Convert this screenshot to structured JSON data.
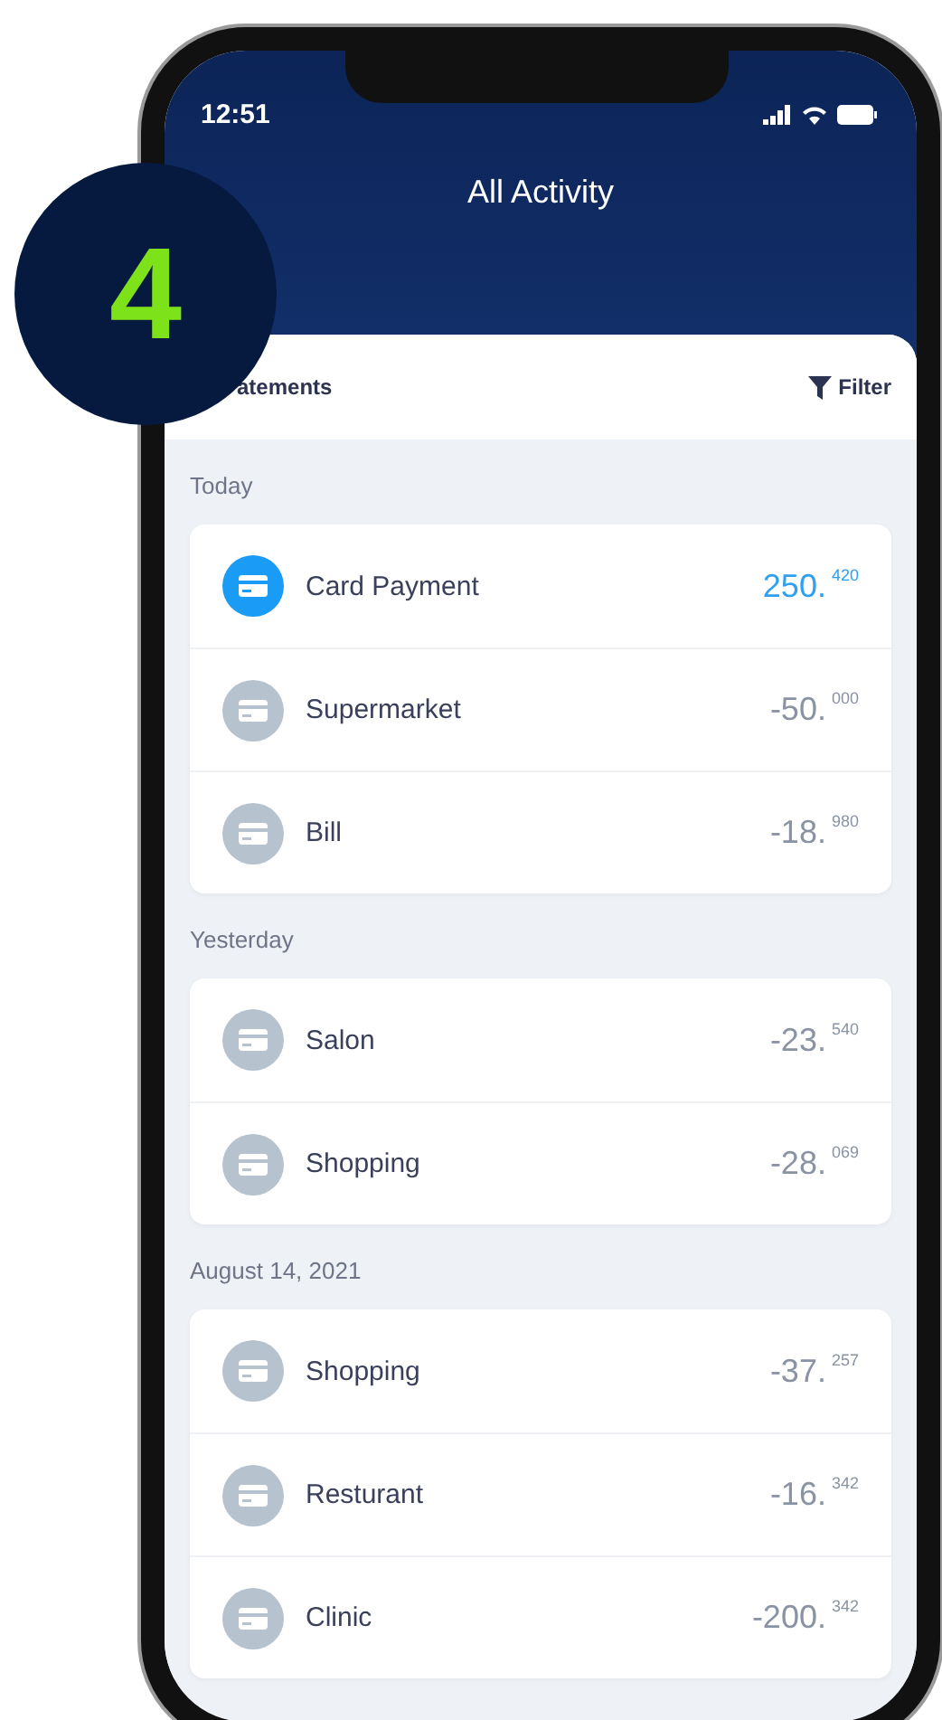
{
  "badge": {
    "number": "4"
  },
  "status_bar": {
    "time": "12:51"
  },
  "header": {
    "title": "All Activity"
  },
  "toolbar": {
    "statements": "atements",
    "filter": "Filter"
  },
  "sections": [
    {
      "label": "Today",
      "items": [
        {
          "name": "Card Payment",
          "amount": "250.",
          "decimals": "420",
          "highlighted": true
        },
        {
          "name": "Supermarket",
          "amount": "-50.",
          "decimals": "000",
          "highlighted": false
        },
        {
          "name": "Bill",
          "amount": "-18.",
          "decimals": "980",
          "highlighted": false
        }
      ]
    },
    {
      "label": "Yesterday",
      "items": [
        {
          "name": "Salon",
          "amount": "-23.",
          "decimals": "540",
          "highlighted": false
        },
        {
          "name": "Shopping",
          "amount": "-28.",
          "decimals": "069",
          "highlighted": false
        }
      ]
    },
    {
      "label": "August 14, 2021",
      "items": [
        {
          "name": "Shopping",
          "amount": "-37.",
          "decimals": "257",
          "highlighted": false
        },
        {
          "name": "Resturant",
          "amount": "-16.",
          "decimals": "342",
          "highlighted": false
        },
        {
          "name": "Clinic",
          "amount": "-200.",
          "decimals": "342",
          "highlighted": false
        }
      ]
    }
  ]
}
